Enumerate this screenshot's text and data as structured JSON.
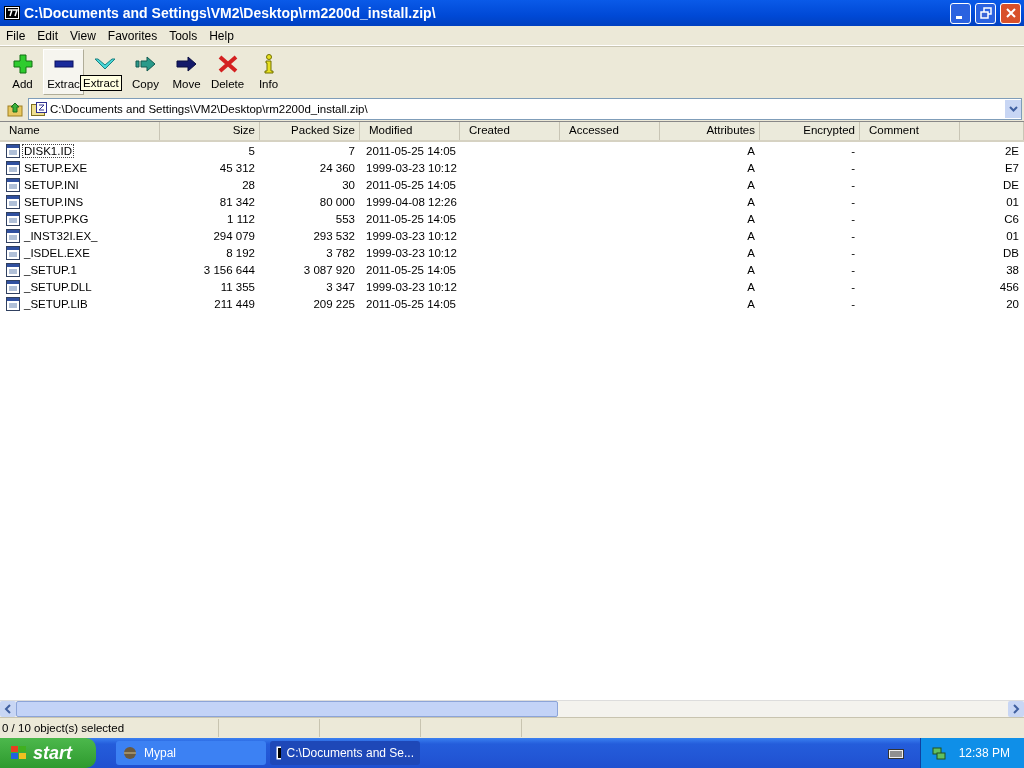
{
  "window": {
    "title": "C:\\Documents and Settings\\VM2\\Desktop\\rm2200d_install.zip\\"
  },
  "menu": [
    "File",
    "Edit",
    "View",
    "Favorites",
    "Tools",
    "Help"
  ],
  "toolbar": [
    {
      "kind": "add",
      "label": "Add",
      "hovered": false
    },
    {
      "kind": "extract",
      "label": "Extrac",
      "hovered": true
    },
    {
      "kind": "test",
      "hovered": false
    },
    {
      "kind": "copy",
      "label": "Copy",
      "hovered": false
    },
    {
      "kind": "move",
      "label": "Move",
      "hovered": false
    },
    {
      "kind": "delete",
      "label": "Delete",
      "hovered": false
    },
    {
      "kind": "info",
      "label": "Info",
      "hovered": false
    }
  ],
  "tooltip": "Extract",
  "address": {
    "value": "C:\\Documents and Settings\\VM2\\Desktop\\rm2200d_install.zip\\"
  },
  "table": {
    "columns": [
      "Name",
      "Size",
      "Packed Size",
      "Modified",
      "Created",
      "Accessed",
      "Attributes",
      "Encrypted",
      "Comment"
    ],
    "rows": [
      {
        "focused": true,
        "cells": [
          "DISK1.ID",
          "5",
          "7",
          "2011-05-25 14:05",
          "",
          "",
          "A",
          "-",
          "",
          "2E"
        ]
      },
      {
        "focused": false,
        "cells": [
          "SETUP.EXE",
          "45 312",
          "24 360",
          "1999-03-23 10:12",
          "",
          "",
          "A",
          "-",
          "",
          "E7"
        ]
      },
      {
        "focused": false,
        "cells": [
          "SETUP.INI",
          "28",
          "30",
          "2011-05-25 14:05",
          "",
          "",
          "A",
          "-",
          "",
          "DE"
        ]
      },
      {
        "focused": false,
        "cells": [
          "SETUP.INS",
          "81 342",
          "80 000",
          "1999-04-08 12:26",
          "",
          "",
          "A",
          "-",
          "",
          "01"
        ]
      },
      {
        "focused": false,
        "cells": [
          "SETUP.PKG",
          "1 112",
          "553",
          "2011-05-25 14:05",
          "",
          "",
          "A",
          "-",
          "",
          "C6"
        ]
      },
      {
        "focused": false,
        "cells": [
          "_INST32I.EX_",
          "294 079",
          "293 532",
          "1999-03-23 10:12",
          "",
          "",
          "A",
          "-",
          "",
          "01"
        ]
      },
      {
        "focused": false,
        "cells": [
          "_ISDEL.EXE",
          "8 192",
          "3 782",
          "1999-03-23 10:12",
          "",
          "",
          "A",
          "-",
          "",
          "DB"
        ]
      },
      {
        "focused": false,
        "cells": [
          "_SETUP.1",
          "3 156 644",
          "3 087 920",
          "2011-05-25 14:05",
          "",
          "",
          "A",
          "-",
          "",
          "38"
        ]
      },
      {
        "focused": false,
        "cells": [
          "_SETUP.DLL",
          "11 355",
          "3 347",
          "1999-03-23 10:12",
          "",
          "",
          "A",
          "-",
          "",
          "456"
        ]
      },
      {
        "focused": false,
        "cells": [
          "_SETUP.LIB",
          "211 449",
          "209 225",
          "2011-05-25 14:05",
          "",
          "",
          "A",
          "-",
          "",
          "20"
        ]
      }
    ]
  },
  "status_bar": [
    "0 / 10 object(s) selected"
  ],
  "taskbar": {
    "start": "start",
    "tasks": [
      {
        "label": "Mypal",
        "selected": false,
        "kind": "browser"
      },
      {
        "label": "C:\\Documents and Se...",
        "selected": true,
        "kind": "archive"
      }
    ],
    "clock": "12:38 PM"
  }
}
